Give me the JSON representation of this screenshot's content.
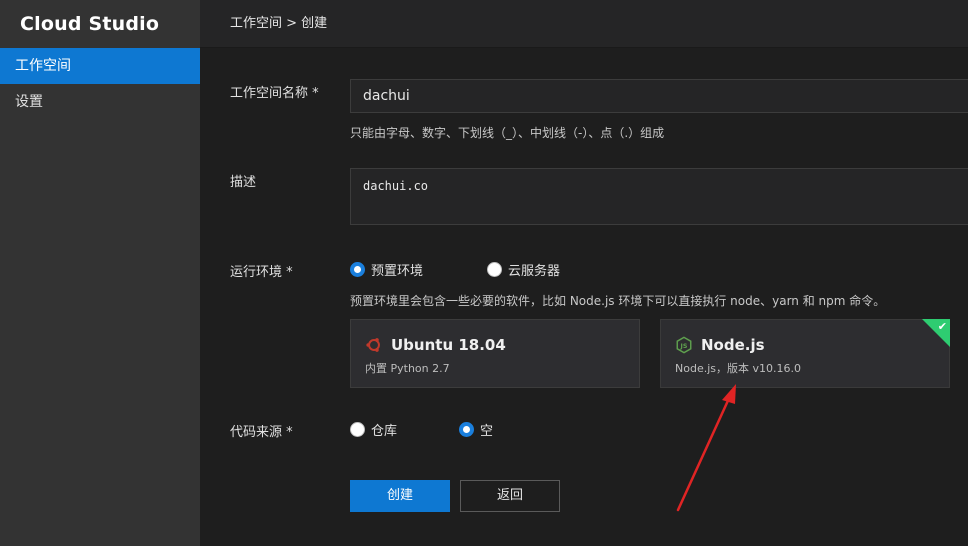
{
  "app": {
    "brand": "Cloud Studio"
  },
  "sidebar": {
    "items": [
      {
        "label": "工作空间",
        "active": true
      },
      {
        "label": "设置",
        "active": false
      }
    ]
  },
  "breadcrumb": "工作空间 > 创建",
  "form": {
    "name": {
      "label": "工作空间名称 *",
      "value": "dachui",
      "hint": "只能由字母、数字、下划线（_）、中划线（-）、点（.）组成"
    },
    "description": {
      "label": "描述",
      "value": "dachui.co"
    },
    "runtime": {
      "label": "运行环境 *",
      "options": [
        {
          "label": "预置环境",
          "checked": true
        },
        {
          "label": "云服务器",
          "checked": false
        }
      ],
      "hint": "预置环境里会包含一些必要的软件，比如 Node.js 环境下可以直接执行 node、yarn 和 npm 命令。",
      "cards": [
        {
          "title": "Ubuntu 18.04",
          "subtitle": "内置 Python 2.7",
          "icon": "ubuntu-icon",
          "selected": false
        },
        {
          "title": "Node.js",
          "subtitle": "Node.js，版本 v10.16.0",
          "icon": "nodejs-icon",
          "selected": true
        }
      ]
    },
    "source": {
      "label": "代码来源 *",
      "options": [
        {
          "label": "仓库",
          "checked": false
        },
        {
          "label": "空",
          "checked": true
        }
      ]
    },
    "buttons": {
      "create": "创建",
      "back": "返回"
    }
  },
  "colors": {
    "accent": "#0e78d2",
    "success": "#2ecc71",
    "annotation": "#e02424"
  }
}
